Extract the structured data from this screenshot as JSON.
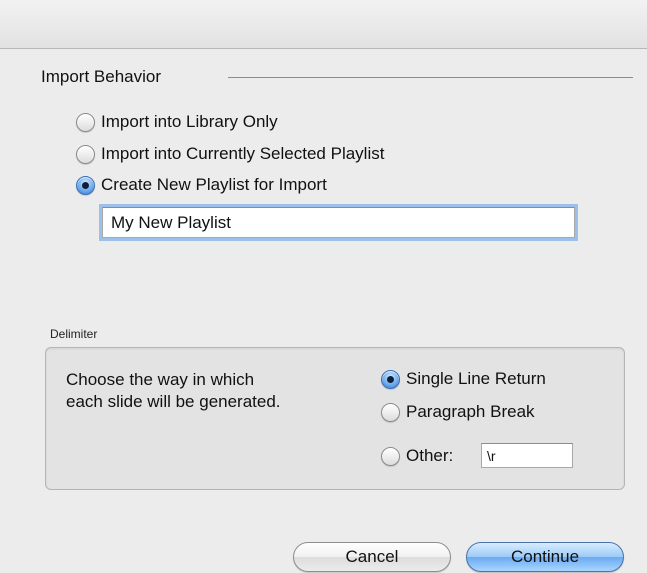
{
  "import_behavior": {
    "title": "Import Behavior",
    "options": [
      {
        "label": "Import into Library Only",
        "checked": false
      },
      {
        "label": "Import into Currently Selected Playlist",
        "checked": false
      },
      {
        "label": "Create New Playlist for Import",
        "checked": true
      }
    ],
    "playlist_name": "My New Playlist"
  },
  "delimiter": {
    "title": "Delimiter",
    "description_line1": "Choose the way in which",
    "description_line2": "each slide will be generated.",
    "options": [
      {
        "label": "Single Line Return",
        "checked": true
      },
      {
        "label": "Paragraph Break",
        "checked": false
      },
      {
        "label": "Other:",
        "checked": false
      }
    ],
    "other_value": "\\r"
  },
  "buttons": {
    "cancel": "Cancel",
    "continue": "Continue"
  },
  "colors": {
    "accent": "#2f78d2",
    "window_bg": "#ececec"
  }
}
